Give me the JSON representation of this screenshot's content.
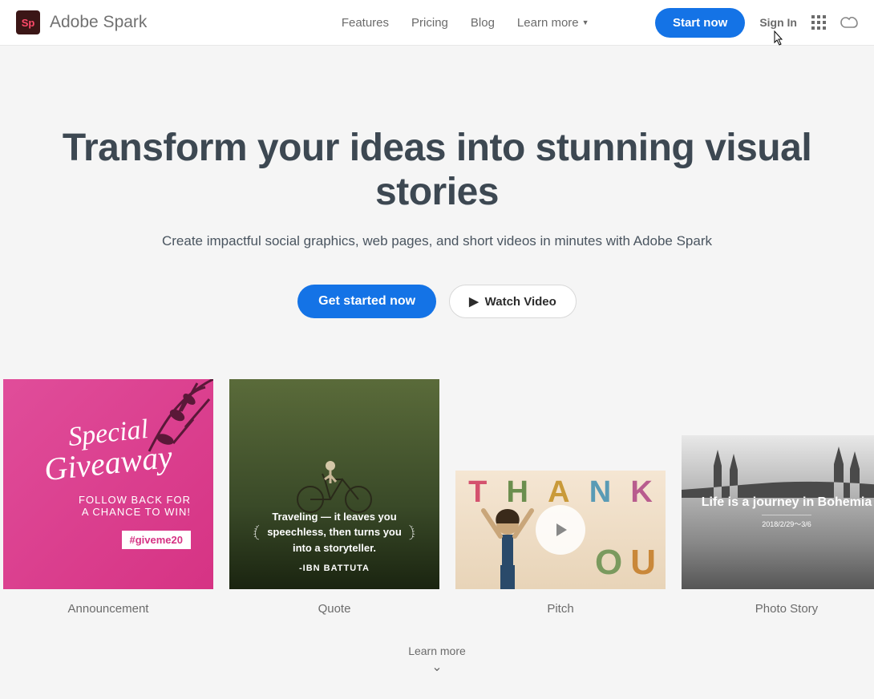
{
  "brand": "Adobe Spark",
  "logo": "Sp",
  "nav": {
    "features": "Features",
    "pricing": "Pricing",
    "blog": "Blog",
    "learn_more": "Learn more"
  },
  "header": {
    "start_now": "Start now",
    "sign_in": "Sign In"
  },
  "hero": {
    "title": "Transform your ideas into stunning visual stories",
    "subtitle": "Create impactful social graphics, web pages, and short videos in minutes with Adobe Spark",
    "get_started": "Get started now",
    "watch_video": "Watch Video"
  },
  "cards": {
    "announcement": {
      "label": "Announcement",
      "title1": "Special",
      "title2": "Giveaway",
      "sub1": "FOLLOW BACK FOR",
      "sub2": "A CHANCE TO WIN!",
      "tag": "#giveme20"
    },
    "quote": {
      "label": "Quote",
      "text": "Traveling — it leaves you speechless, then turns you into a storyteller.",
      "author": "-IBN BATTUTA"
    },
    "pitch": {
      "label": "Pitch",
      "word1": "THANK",
      "word2": "YOU"
    },
    "photo": {
      "label": "Photo Story",
      "title": "Life is a journey in Bohemia",
      "date": "2018/2/29～3/6"
    }
  },
  "footer": {
    "learn_more": "Learn more"
  }
}
